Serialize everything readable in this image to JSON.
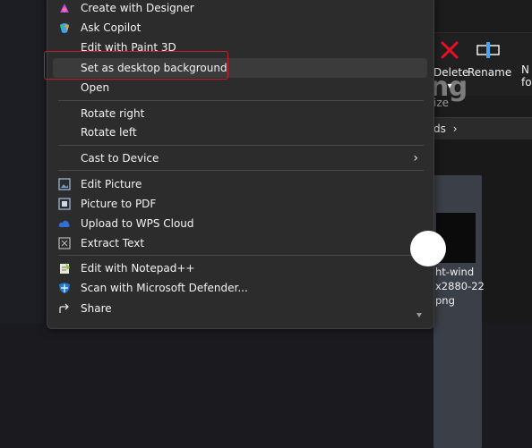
{
  "menu": {
    "items": [
      {
        "label": "Create with Designer",
        "icon": "designer-icon"
      },
      {
        "label": "Ask Copilot",
        "icon": "copilot-icon"
      },
      {
        "label": "Edit with Paint 3D",
        "icon": "paint3d-icon"
      },
      {
        "label": "Set as desktop background",
        "icon": "none"
      },
      {
        "label": "Open",
        "icon": "none"
      },
      {
        "label": "Rotate right",
        "icon": "none"
      },
      {
        "label": "Rotate left",
        "icon": "none"
      },
      {
        "label": "Cast to Device",
        "icon": "none",
        "submenu": true
      },
      {
        "label": "Edit Picture",
        "icon": "edit-picture-icon"
      },
      {
        "label": "Picture to PDF",
        "icon": "pdf-icon"
      },
      {
        "label": "Upload to WPS Cloud",
        "icon": "wps-cloud-icon"
      },
      {
        "label": "Extract Text",
        "icon": "extract-text-icon"
      },
      {
        "label": "Edit with Notepad++",
        "icon": "notepad-plus-plus-icon"
      },
      {
        "label": "Scan with Microsoft Defender...",
        "icon": "defender-icon"
      },
      {
        "label": "Share",
        "icon": "share-icon"
      }
    ],
    "submenu_arrow": "›"
  },
  "explorer": {
    "delete_label": "Delete",
    "rename_label": "Rename",
    "more_line1": "N",
    "more_line2": "fo",
    "subhead": "ize",
    "dropdown_arrow": "▾",
    "crumb": "ds",
    "crumb_sep": "›",
    "file_name_lines": [
      "ht-wind",
      "x2880-22",
      "png"
    ]
  },
  "watermark": {
    "text": "uantrimang"
  },
  "colors": {
    "accent": "#c4202a",
    "menu_bg": "#2c2c2c",
    "highlight": "#3b3b3b"
  }
}
